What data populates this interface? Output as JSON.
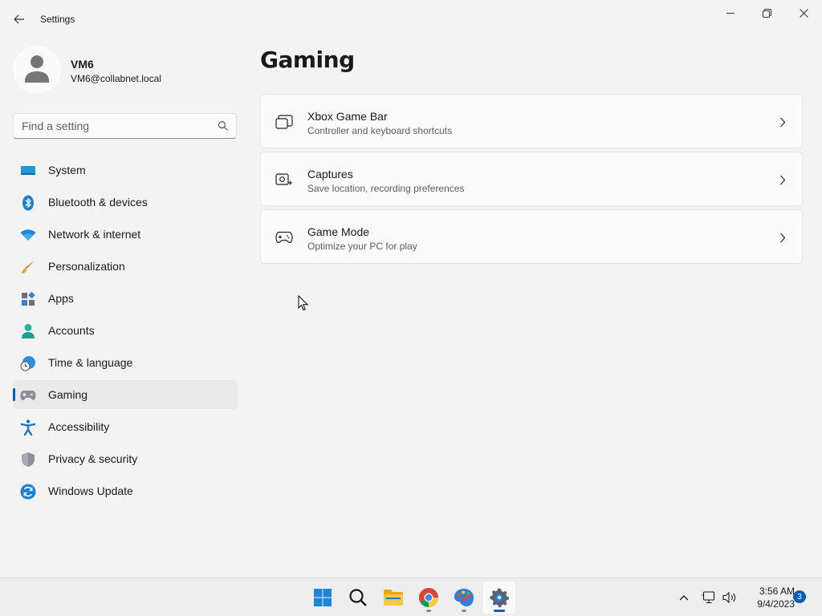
{
  "window": {
    "title": "Settings"
  },
  "user": {
    "name": "VM6",
    "email": "VM6@collabnet.local"
  },
  "search": {
    "placeholder": "Find a setting",
    "value": ""
  },
  "nav": [
    {
      "label": "System",
      "icon": "system-icon",
      "selected": false
    },
    {
      "label": "Bluetooth & devices",
      "icon": "bluetooth-icon",
      "selected": false
    },
    {
      "label": "Network & internet",
      "icon": "wifi-icon",
      "selected": false
    },
    {
      "label": "Personalization",
      "icon": "brush-icon",
      "selected": false
    },
    {
      "label": "Apps",
      "icon": "apps-icon",
      "selected": false
    },
    {
      "label": "Accounts",
      "icon": "accounts-icon",
      "selected": false
    },
    {
      "label": "Time & language",
      "icon": "globe-clock-icon",
      "selected": false
    },
    {
      "label": "Gaming",
      "icon": "gamepad-icon",
      "selected": true
    },
    {
      "label": "Accessibility",
      "icon": "accessibility-icon",
      "selected": false
    },
    {
      "label": "Privacy & security",
      "icon": "shield-icon",
      "selected": false
    },
    {
      "label": "Windows Update",
      "icon": "update-icon",
      "selected": false
    }
  ],
  "page": {
    "title": "Gaming",
    "cards": [
      {
        "title": "Xbox Game Bar",
        "subtitle": "Controller and keyboard shortcuts",
        "icon": "game-bar-icon"
      },
      {
        "title": "Captures",
        "subtitle": "Save location, recording preferences",
        "icon": "capture-icon"
      },
      {
        "title": "Game Mode",
        "subtitle": "Optimize your PC for play",
        "icon": "game-mode-icon"
      }
    ]
  },
  "taskbar": {
    "apps": [
      "start-icon",
      "search-icon",
      "file-explorer-icon",
      "chrome-icon",
      "paint-icon",
      "settings-icon"
    ],
    "active_app": "settings-icon",
    "time": "3:56 AM",
    "date": "9/4/2023",
    "notification_count": "3"
  },
  "colors": {
    "accent": "#005fb8",
    "background": "#f3f3f3",
    "card": "#fbfbfb"
  }
}
